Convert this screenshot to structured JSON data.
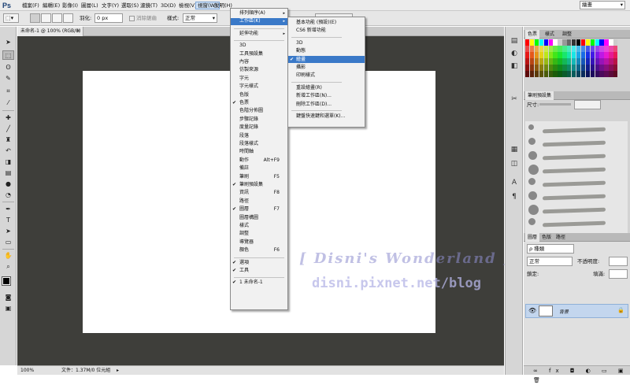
{
  "app": {
    "logo": "Ps"
  },
  "menubar": {
    "items": [
      "檔案(F)",
      "編輯(E)",
      "影像(I)",
      "圖層(L)",
      "文字(Y)",
      "選取(S)",
      "濾鏡(T)",
      "3D(D)",
      "檢視(V)",
      "視窗(W)",
      "說明(H)"
    ],
    "active_index": 9,
    "workspace_select": "繪畫",
    "controls": [
      "–",
      "□",
      "×"
    ]
  },
  "options": {
    "feather_label": "羽化:",
    "feather_value": "0 px",
    "antialias_label": "消除鋸齒",
    "style_label": "樣式:",
    "style_value": "正常"
  },
  "document": {
    "tab_label": "未命名-1 @ 100% (RGB/8)",
    "close": "×"
  },
  "status": {
    "zoom": "100%",
    "info": "文件：1.37M/0 位元組"
  },
  "watermark": {
    "line1": "[ Disni's Wonderland ]",
    "line2": "disni.pixnet.net/blog"
  },
  "panels": {
    "color_tabs": [
      "色票",
      "樣式",
      "調整"
    ],
    "brush_tab": "筆刷預設集",
    "brush_size_label": "尺寸:",
    "layers_tabs": [
      "圖層",
      "色版",
      "路徑"
    ],
    "layers_kind": "ρ 種類",
    "blend_mode": "正常",
    "opacity_label": "不透明度:",
    "lock_label": "鎖定:",
    "fill_label": "填滿:",
    "layer_name": "背景",
    "brush_sizes": [
      7,
      9,
      11,
      13,
      9,
      11,
      13,
      9
    ]
  },
  "window_menu": {
    "items": [
      {
        "label": "排列順序(A)",
        "arrow": "▸"
      },
      {
        "label": "工作區(K)",
        "arrow": "▸",
        "highlighted": true
      },
      {
        "sep": true
      },
      {
        "label": "延伸功能",
        "arrow": "▸"
      },
      {
        "sep": true
      },
      {
        "label": "3D"
      },
      {
        "label": "工具預設集"
      },
      {
        "label": "內容"
      },
      {
        "label": "仿製來源"
      },
      {
        "label": "字元"
      },
      {
        "label": "字元樣式"
      },
      {
        "label": "色版"
      },
      {
        "label": "色票",
        "check": "✔"
      },
      {
        "label": "色階分佈圖"
      },
      {
        "label": "步驟記錄"
      },
      {
        "label": "度量記錄"
      },
      {
        "label": "段落"
      },
      {
        "label": "段落樣式"
      },
      {
        "label": "時間軸"
      },
      {
        "label": "動作",
        "shortcut": "Alt+F9"
      },
      {
        "label": "備註"
      },
      {
        "label": "筆刷",
        "shortcut": "F5"
      },
      {
        "label": "筆刷預設集",
        "check": "✔"
      },
      {
        "label": "資訊",
        "shortcut": "F8"
      },
      {
        "label": "路徑"
      },
      {
        "label": "圖層",
        "shortcut": "F7",
        "check": "✔"
      },
      {
        "label": "圖層構圖"
      },
      {
        "label": "樣式"
      },
      {
        "label": "調整"
      },
      {
        "label": "導覽器"
      },
      {
        "label": "顏色",
        "shortcut": "F6"
      },
      {
        "sep": true
      },
      {
        "label": "選項",
        "check": "✔"
      },
      {
        "label": "工具",
        "check": "✔"
      },
      {
        "sep": true
      },
      {
        "label": "1 未命名-1",
        "check": "✔"
      }
    ]
  },
  "workspace_submenu": {
    "items": [
      {
        "label": "基本功能 (預設)(E)"
      },
      {
        "label": "CS6 新增功能"
      },
      {
        "sep": true
      },
      {
        "label": "3D"
      },
      {
        "label": "動態"
      },
      {
        "label": "繪畫",
        "check": "✔",
        "highlighted": true
      },
      {
        "label": "攝影"
      },
      {
        "label": "印刷樣式"
      },
      {
        "sep": true
      },
      {
        "label": "重設繪畫(R)"
      },
      {
        "label": "新增工作區(N)..."
      },
      {
        "label": "刪除工作區(D)..."
      },
      {
        "sep": true
      },
      {
        "label": "鍵盤快速鍵和選單(K)..."
      }
    ]
  }
}
